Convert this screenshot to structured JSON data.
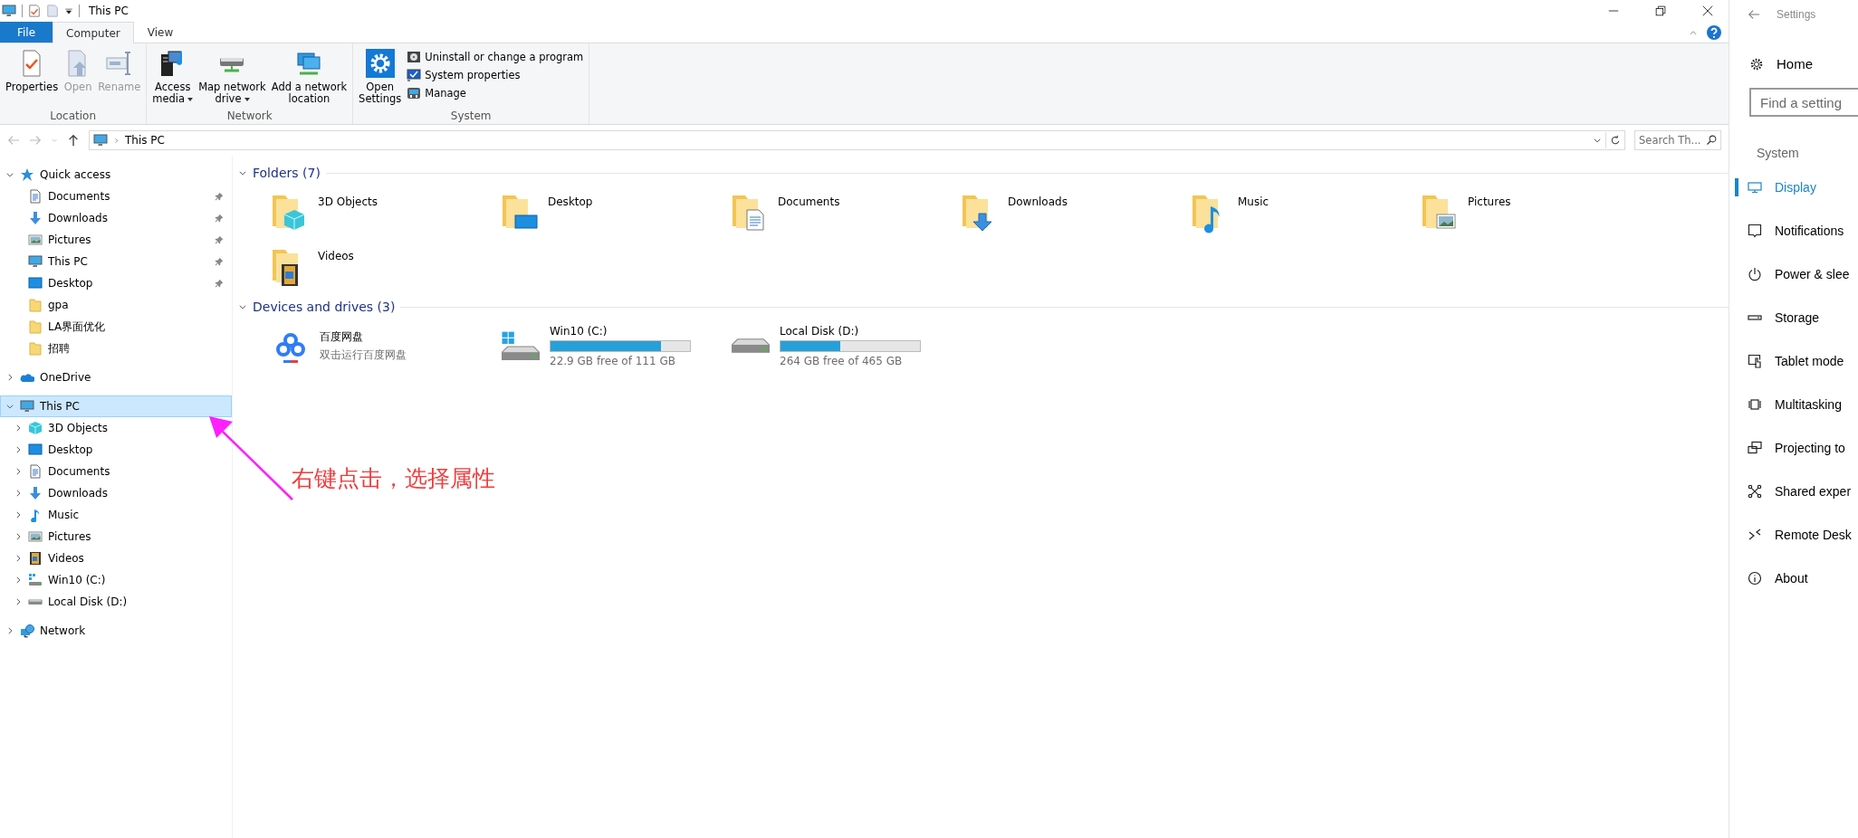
{
  "explorer": {
    "window": {
      "title": "This PC"
    },
    "ribbon_tabs": [
      {
        "label": "File",
        "kind": "file",
        "selected": false
      },
      {
        "label": "Computer",
        "kind": "tab",
        "selected": true
      },
      {
        "label": "View",
        "kind": "tab",
        "selected": false
      }
    ],
    "ribbon_groups": [
      {
        "label": "Location",
        "commands": [
          {
            "lines": [
              "Properties"
            ],
            "kind": "properties",
            "disabled": false
          },
          {
            "lines": [
              "Open"
            ],
            "kind": "open",
            "disabled": true
          },
          {
            "lines": [
              "Rename"
            ],
            "kind": "rename",
            "disabled": true
          }
        ]
      },
      {
        "label": "Network",
        "commands": [
          {
            "lines": [
              "Access",
              "media"
            ],
            "kind": "media",
            "disabled": false,
            "dropdown": true
          },
          {
            "lines": [
              "Map network",
              "drive"
            ],
            "kind": "mapdrive",
            "disabled": false,
            "dropdown": true
          },
          {
            "lines": [
              "Add a network",
              "location"
            ],
            "kind": "netloc",
            "disabled": false
          }
        ]
      },
      {
        "label": "System",
        "commands": [
          {
            "lines": [
              "Open",
              "Settings"
            ],
            "kind": "settings",
            "disabled": false
          }
        ],
        "small_commands": [
          {
            "label": "Uninstall or change a program",
            "kind": "uninstall",
            "disabled": false
          },
          {
            "label": "System properties",
            "kind": "sysprops",
            "disabled": false
          },
          {
            "label": "Manage",
            "kind": "manage",
            "disabled": false
          }
        ]
      }
    ],
    "address": {
      "path": "This PC",
      "search_placeholder": "Search Th..."
    },
    "nav": [
      {
        "label": "Quick access",
        "kind": "star",
        "expanded": true,
        "selected": false,
        "children": [
          {
            "label": "Documents",
            "kind": "documents",
            "pinned": true,
            "selected": false
          },
          {
            "label": "Downloads",
            "kind": "downloads",
            "pinned": true,
            "selected": false
          },
          {
            "label": "Pictures",
            "kind": "pictures",
            "pinned": true,
            "selected": false
          },
          {
            "label": "This PC",
            "kind": "computer",
            "pinned": true,
            "selected": false
          },
          {
            "label": "Desktop",
            "kind": "desktop",
            "pinned": true,
            "selected": false
          },
          {
            "label": "gpa",
            "kind": "folder",
            "pinned": false,
            "selected": false
          },
          {
            "label": "LA界面优化",
            "kind": "folder",
            "pinned": false,
            "selected": false
          },
          {
            "label": "招聘",
            "kind": "folder",
            "pinned": false,
            "selected": false
          }
        ]
      },
      {
        "label": "OneDrive",
        "kind": "onedrive",
        "expanded": false,
        "selected": false
      },
      {
        "label": "This PC",
        "kind": "computer",
        "expanded": true,
        "selected": true,
        "children": [
          {
            "label": "3D Objects",
            "kind": "cube",
            "expanded": false,
            "selected": false
          },
          {
            "label": "Desktop",
            "kind": "desktop",
            "expanded": false,
            "selected": false
          },
          {
            "label": "Documents",
            "kind": "documents",
            "expanded": false,
            "selected": false
          },
          {
            "label": "Downloads",
            "kind": "downloads",
            "expanded": false,
            "selected": false
          },
          {
            "label": "Music",
            "kind": "music",
            "expanded": false,
            "selected": false
          },
          {
            "label": "Pictures",
            "kind": "pictures",
            "expanded": false,
            "selected": false
          },
          {
            "label": "Videos",
            "kind": "videos",
            "expanded": false,
            "selected": false
          },
          {
            "label": "Win10 (C:)",
            "kind": "windrive",
            "expanded": false,
            "selected": false
          },
          {
            "label": "Local Disk (D:)",
            "kind": "drive",
            "expanded": false,
            "selected": false
          }
        ]
      },
      {
        "label": "Network",
        "kind": "network",
        "expanded": false,
        "selected": false
      }
    ],
    "sections": [
      {
        "heading": "Folders (7)",
        "expanded": true,
        "items": [
          {
            "name": "3D Objects",
            "kind": "cube"
          },
          {
            "name": "Desktop",
            "kind": "desktop"
          },
          {
            "name": "Documents",
            "kind": "documents"
          },
          {
            "name": "Downloads",
            "kind": "downloads"
          },
          {
            "name": "Music",
            "kind": "music"
          },
          {
            "name": "Pictures",
            "kind": "pictures"
          },
          {
            "name": "Videos",
            "kind": "videos"
          }
        ]
      },
      {
        "heading": "Devices and drives (3)",
        "expanded": true,
        "items": [
          {
            "name": "百度网盘",
            "kind": "app",
            "subtitle": "双击运行百度网盘"
          },
          {
            "name": "Win10 (C:)",
            "kind": "windrive",
            "level": 0.79,
            "free": "22.9 GB free of 111 GB"
          },
          {
            "name": "Local Disk (D:)",
            "kind": "drive",
            "level": 0.43,
            "free": "264 GB free of 465 GB"
          }
        ]
      }
    ],
    "annotation": {
      "text": "右键点击，选择属性"
    }
  },
  "settings": {
    "title": "Settings",
    "home": "Home",
    "search_placeholder": "Find a setting",
    "section": "System",
    "items": [
      {
        "label": "Display",
        "kind": "display",
        "selected": true
      },
      {
        "label": "Notifications",
        "kind": "notifications",
        "selected": false
      },
      {
        "label": "Power & slee",
        "kind": "power",
        "selected": false
      },
      {
        "label": "Storage",
        "kind": "storage",
        "selected": false
      },
      {
        "label": "Tablet mode",
        "kind": "tablet",
        "selected": false
      },
      {
        "label": "Multitasking",
        "kind": "multitasking",
        "selected": false
      },
      {
        "label": "Projecting to",
        "kind": "projecting",
        "selected": false
      },
      {
        "label": "Shared exper",
        "kind": "shared",
        "selected": false
      },
      {
        "label": "Remote Desk",
        "kind": "remote",
        "selected": false
      },
      {
        "label": "About",
        "kind": "about",
        "selected": false
      }
    ]
  }
}
